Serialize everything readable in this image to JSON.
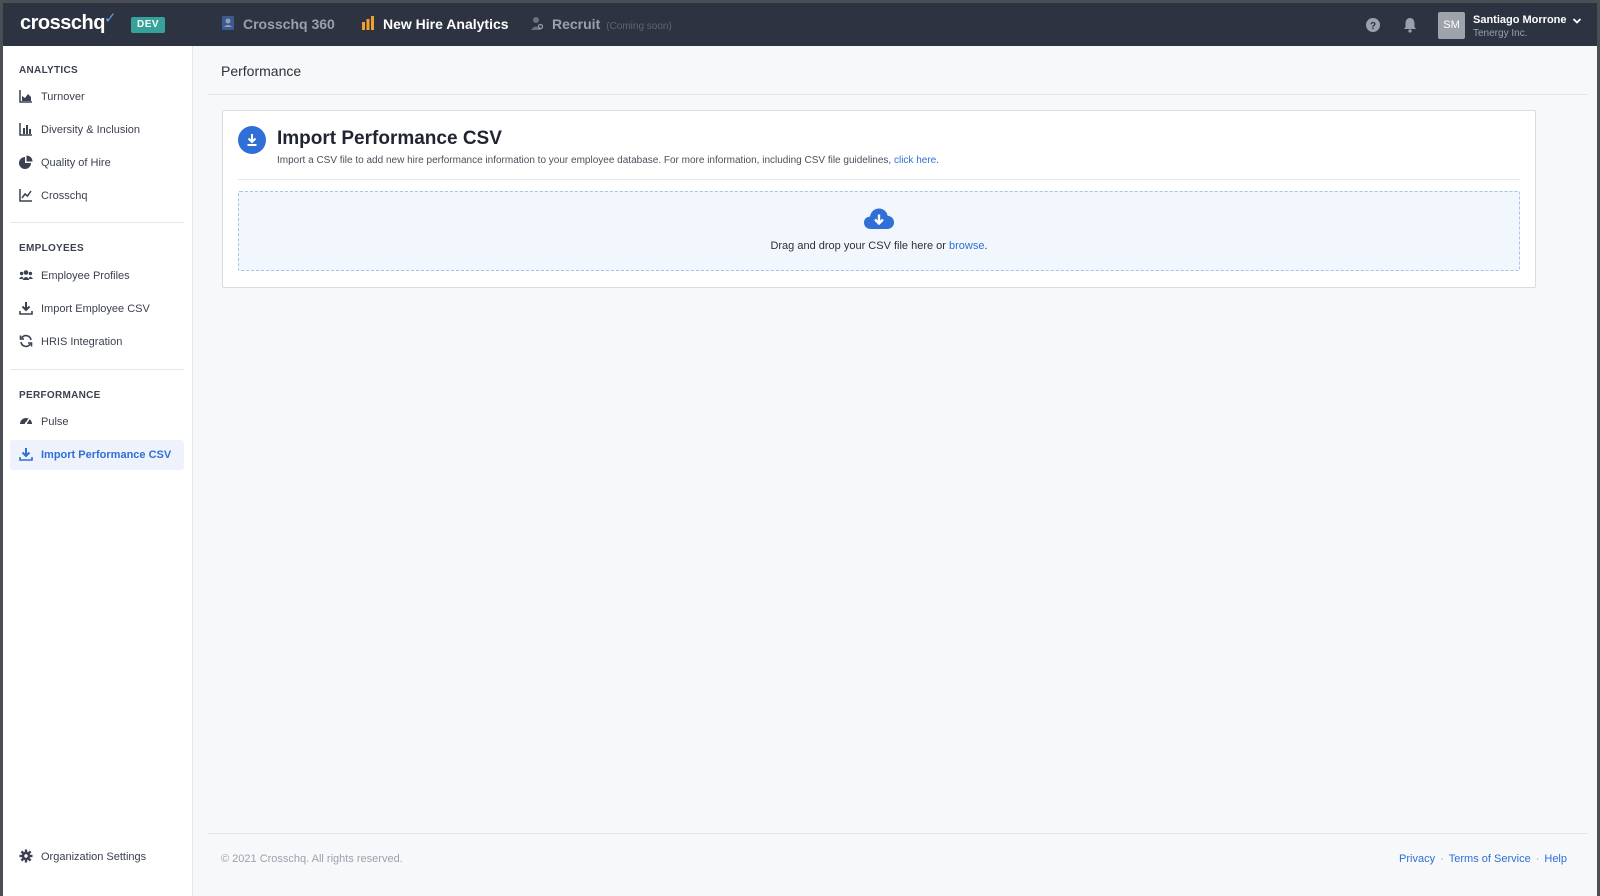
{
  "header": {
    "logo": "crosschq",
    "badge": "DEV",
    "nav": [
      {
        "label": "Crosschq 360",
        "icon": "profile-icon"
      },
      {
        "label": "New Hire Analytics",
        "icon": "bar-chart-icon"
      },
      {
        "label": "Recruit",
        "icon": "person-search-icon",
        "note": "(Coming soon)"
      }
    ],
    "user": {
      "initials": "SM",
      "name": "Santiago Morrone",
      "org": "Tenergy Inc."
    }
  },
  "sidebar": {
    "sections": [
      {
        "title": "ANALYTICS",
        "items": [
          {
            "label": "Turnover",
            "icon": "area-chart-icon"
          },
          {
            "label": "Diversity & Inclusion",
            "icon": "bar-chart-icon"
          },
          {
            "label": "Quality of Hire",
            "icon": "pie-chart-icon"
          },
          {
            "label": "Crosschq",
            "icon": "line-chart-icon"
          }
        ]
      },
      {
        "title": "EMPLOYEES",
        "items": [
          {
            "label": "Employee Profiles",
            "icon": "users-icon"
          },
          {
            "label": "Import Employee CSV",
            "icon": "download-icon"
          },
          {
            "label": "HRIS Integration",
            "icon": "sync-icon"
          }
        ]
      },
      {
        "title": "PERFORMANCE",
        "items": [
          {
            "label": "Pulse",
            "icon": "gauge-icon"
          },
          {
            "label": "Import Performance CSV",
            "icon": "download-icon",
            "active": true
          }
        ]
      }
    ],
    "settings_label": "Organization Settings"
  },
  "main": {
    "page_title": "Performance",
    "card": {
      "title": "Import Performance CSV",
      "description": "Import a CSV file to add new hire performance information to your employee database. For more information, including CSV file guidelines,",
      "description_link": "click here",
      "description_end": ".",
      "drop_text": "Drag and drop your CSV file here or",
      "drop_link": "browse",
      "drop_end": "."
    }
  },
  "footer": {
    "copyright": "© 2021 Crosschq. All rights reserved.",
    "links": [
      "Privacy",
      "Terms of Service",
      "Help"
    ]
  },
  "colors": {
    "topbar": "#2d3340",
    "accent": "#2f6fd6",
    "badge": "#35a39a",
    "orange": "#f0a02c"
  }
}
